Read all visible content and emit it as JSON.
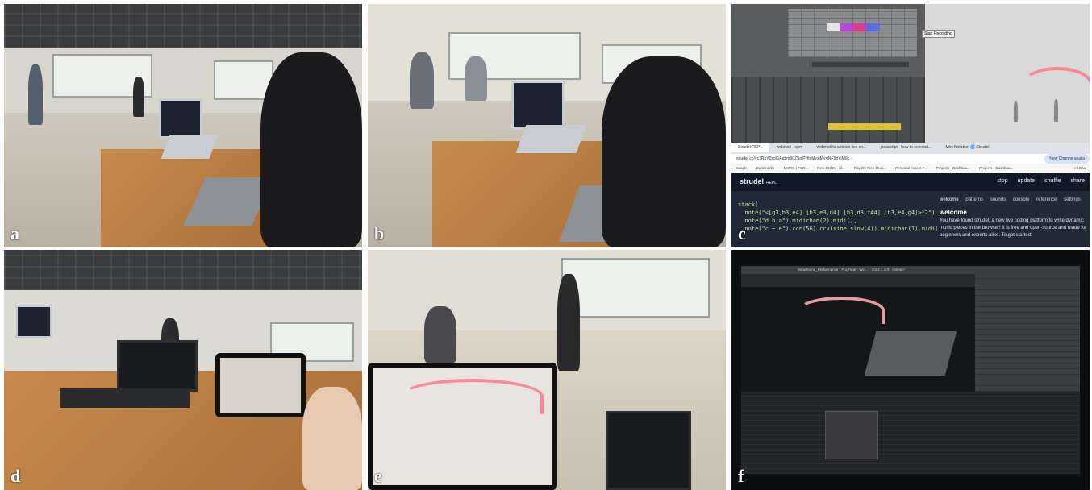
{
  "panels": [
    {
      "id": "a",
      "label": "a"
    },
    {
      "id": "b",
      "label": "b"
    },
    {
      "id": "c",
      "label": "c"
    },
    {
      "id": "d",
      "label": "d"
    },
    {
      "id": "e",
      "label": "e"
    },
    {
      "id": "f",
      "label": "f"
    }
  ],
  "panel_c": {
    "ableton_tooltip": "Start Recording",
    "browser_tabs": [
      "Strudel REPL",
      "webmidi - npm",
      "webmidi to ableton live on...",
      "javascript - how to connect...",
      "Mini Notation 🌀 Strudel"
    ],
    "address_bar": "strudel.cc/#c3RhY2soCiAgbm90ZSgiPHtnMyxiMyxlNF9gYjM0c...",
    "new_chrome_notice": "New Chrome availa",
    "bookmarks": [
      "Google",
      "Bookmarks",
      "MMRC | FSD...",
      "New CUHK - ul...",
      "Royalty Free Musi...",
      "Personal Assets T...",
      "Projects - Dashboa...",
      "Projects - Dashboa..."
    ],
    "all_bookmarks": "All Boo",
    "strudel": {
      "brand": "strudel",
      "brand_sub": "REPL",
      "menu": [
        "stop",
        "update",
        "shuffle",
        "share"
      ],
      "code_lines": [
        "stack(",
        "  note(\"<[g3,b3,e4] [b3,e3,d4] [b3,d3,f#4] [b3,e4,g4]>*2\").midichan",
        "  note(\"d b a\").midichan(2).midi(),",
        "  note(\"c ~ e\").ccn(56).ccv(sine.slow(4)).midichan(1).midi()"
      ],
      "side_tabs": [
        "welcome",
        "patterns",
        "sounds",
        "console",
        "reference",
        "settings"
      ],
      "welcome_heading": "welcome",
      "welcome_text": "You have found strudel, a new live coding platform to write dynamic music pieces in the browser! It is free and open-source and made for beginners and experts alike. To get started:"
    }
  },
  "panel_f": {
    "window_title": "Wearframe_Performance - ProjFinal - Win... - 2024.1.10f1 <Metal>"
  }
}
